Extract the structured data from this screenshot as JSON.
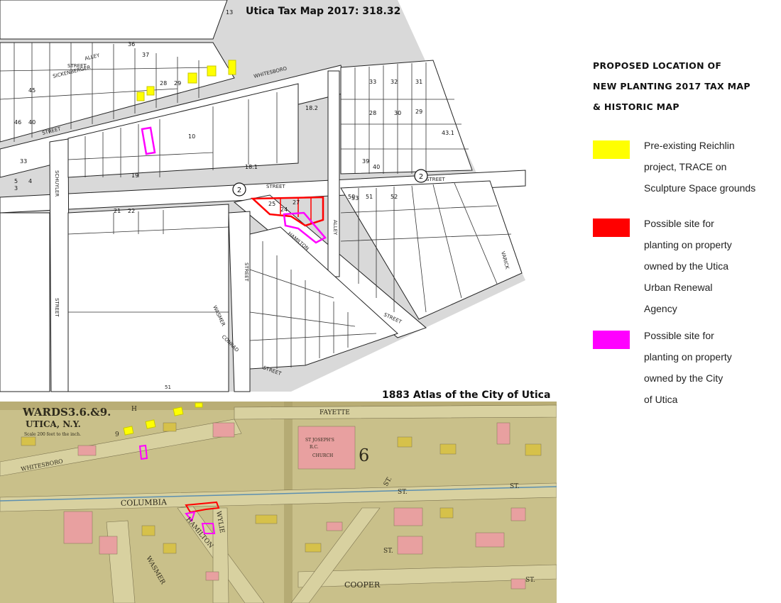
{
  "tax_map": {
    "title": "Utica Tax Map 2017:  318.32",
    "street_labels": [
      "STREET",
      "STREET",
      "STREET",
      "STREET",
      "STREET",
      "STREET",
      "STREET",
      "STREET",
      "WHITESBORO",
      "HAMILTON",
      "SCHUYLER",
      "SICKENBERGER",
      "ALLEY",
      "ALLEY",
      "VARICK",
      "WASMER",
      "CONRAD"
    ],
    "lot_numbers": [
      "36",
      "37",
      "33",
      "32",
      "31",
      "28",
      "30",
      "18.2",
      "29",
      "10",
      "18.1",
      "19",
      "21",
      "22",
      "50",
      "51",
      "52",
      "53",
      "25",
      "27",
      "24",
      "13",
      "43.1",
      "39",
      "40",
      "33",
      "4",
      "5",
      "46",
      "40",
      "45",
      "3",
      "28",
      "29"
    ],
    "district_numbers": [
      "2",
      "2"
    ],
    "footer_number": "51"
  },
  "atlas": {
    "title": "1883 Atlas of the City of Utica",
    "heading_line1": "WARDS3.6.&9.",
    "heading_line2": "UTICA, N.Y.",
    "scale_text": "Scale 200 feet to the inch.",
    "section_numbers": [
      "9",
      "H",
      "6"
    ],
    "streets": [
      "WHITESBORO",
      "COLUMBIA",
      "FAYETTE",
      "HAMILTON",
      "WASMER",
      "WYLIE",
      "COOPER",
      "ST.",
      "ST.",
      "ST.",
      "ST.",
      "ST."
    ],
    "church_lines": [
      "ST JOSEPH'S",
      "R.C.",
      "CHURCH"
    ]
  },
  "legend": {
    "heading": [
      "PROPOSED LOCATION OF",
      "NEW PLANTING 2017 TAX MAP",
      "& HISTORIC MAP"
    ],
    "items": [
      {
        "color": "#ffff00",
        "text": "Pre-existing Reichlin\nproject, TRACE on\nSculpture Space grounds"
      },
      {
        "color": "#ff0000",
        "text": "Possible site for\nplanting on property\nowned by the Utica\nUrban Renewal\nAgency"
      },
      {
        "color": "#ff00ff",
        "text": "Possible site for\nplanting on property\nowned by the City\nof Utica"
      }
    ]
  }
}
